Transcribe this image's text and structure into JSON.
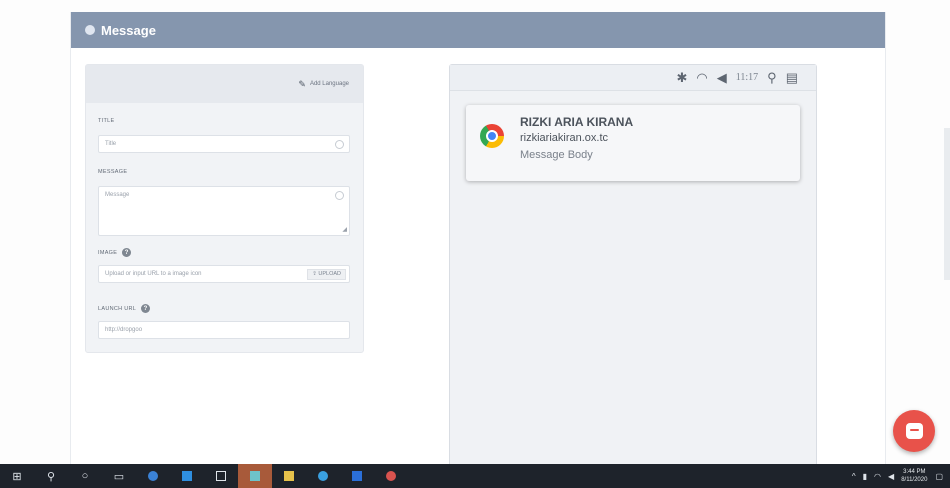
{
  "header": {
    "title": "Message"
  },
  "form": {
    "add_language": "Add Language",
    "title_label": "TITLE",
    "title_placeholder": "Title",
    "message_label": "MESSAGE",
    "message_placeholder": "Message",
    "image_label": "IMAGE",
    "image_placeholder": "Upload or input URL to a image icon",
    "upload_label": "UPLOAD",
    "launch_label": "LAUNCH URL",
    "launch_placeholder": "http://dropgoo"
  },
  "preview": {
    "status": {
      "time": "11:17"
    },
    "notification": {
      "title": "RIZKI ARIA KIRANA",
      "site": "rizkiariakiran.ox.tc",
      "body": "Message Body"
    }
  },
  "taskbar": {
    "clock_time": "3:44 PM",
    "clock_date": "8/11/2020"
  },
  "colors": {
    "header": "#8596ae",
    "fab": "#e8524a",
    "taskbar": "#1e232b"
  }
}
